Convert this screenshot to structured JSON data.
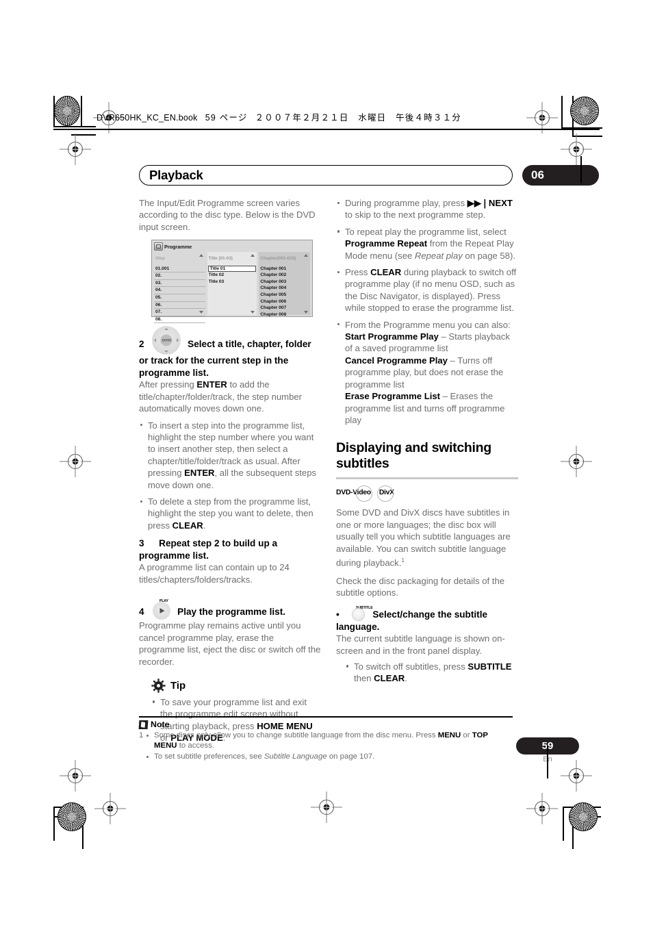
{
  "print_header": {
    "filename": "DVR650HK_KC_EN.book",
    "page_marker": "59 ページ",
    "date_jp": "２００７年２月２１日　水曜日　午後４時３１分"
  },
  "chapter": {
    "title": "Playback",
    "number": "06"
  },
  "left_column": {
    "intro": "The Input/Edit Programme screen varies according to the disc type. Below is the DVD input screen.",
    "osd": {
      "window_title": "Programme",
      "columns": [
        {
          "header": "Step",
          "rows": [
            "01.001",
            "02.",
            "03.",
            "04.",
            "05.",
            "06.",
            "07.",
            "08."
          ]
        },
        {
          "header": "Title (01-03)",
          "rows": [
            "Title 01",
            "Title 02",
            "Title 03"
          ]
        },
        {
          "header": "Chapter(001-015)",
          "rows": [
            "Chapter 001",
            "Chapter 002",
            "Chapter 003",
            "Chapter 004",
            "Chapter 005",
            "Chapter 006",
            "Chapter 007",
            "Chapter 008"
          ]
        }
      ],
      "selected_row": "Title 01"
    },
    "step2": {
      "num": "2",
      "key_caption": "ENTER",
      "heading": "Select a title, chapter, folder or track for the current step in the programme list.",
      "body_pre": "After pressing ",
      "body_bold": "ENTER",
      "body_post": " to add the title/chapter/folder/track, the step number automatically moves down one."
    },
    "step2_bullets": [
      {
        "pre": "To insert a step into the programme list, highlight the step number where you want to insert another step, then select a chapter/title/folder/track as usual. After pressing ",
        "bold": "ENTER",
        "post": ", all the subsequent steps move down one."
      },
      {
        "pre": "To delete a step from the programme list, highlight the step you want to delete, then press ",
        "bold": "CLEAR",
        "post": "."
      }
    ],
    "step3": {
      "num": "3",
      "heading": "Repeat step 2 to build up a programme list.",
      "body": "A programme list can contain up to 24 titles/chapters/folders/tracks."
    },
    "step4": {
      "num": "4",
      "key_caption": "PLAY",
      "heading": "Play the programme list.",
      "body": "Programme play remains active until you cancel programme play, erase the programme list, eject the disc or switch off the recorder."
    },
    "tip": {
      "label": "Tip",
      "bullet_pre": "To save your programme list and exit the programme edit screen without starting playback, press ",
      "bullet_bold1": "HOME MENU",
      "bullet_mid": " or ",
      "bullet_bold2": "PLAY MODE",
      "bullet_post": "."
    }
  },
  "right_column": {
    "bullets": [
      {
        "pre": "During programme play, press ",
        "glyph": "▶▶❘",
        "bold": "NEXT",
        "post": " to skip to the next programme step."
      },
      {
        "pre": "To repeat play the programme list, select ",
        "bold": "Programme Repeat",
        "mid": " from the Repeat Play Mode menu (see ",
        "italic": "Repeat play",
        "post": " on page 58)."
      },
      {
        "pre": "Press ",
        "bold": "CLEAR",
        "post": " during playback to switch off programme play (if no menu OSD, such as the Disc Navigator, is displayed). Press while stopped to erase the programme list."
      }
    ],
    "menu_bullet": {
      "intro": "From the Programme menu you can also:",
      "items": [
        {
          "name": "Start Programme Play",
          "desc": " – Starts playback of a saved programme list"
        },
        {
          "name": "Cancel Programme Play",
          "desc": " – Turns off programme play, but does not erase the programme list"
        },
        {
          "name": "Erase Programme List",
          "desc": " – Erases the programme list and turns off programme play"
        }
      ]
    },
    "section": {
      "heading": "Displaying and switching subtitles",
      "badges": [
        "DVD-Video",
        "DivX"
      ],
      "para1_pre": "Some DVD and DivX discs have subtitles in one or more languages; the disc box will usually tell you which subtitle languages are available. You can switch subtitle language during playback.",
      "para1_footnote": "1",
      "para2": "Check the disc packaging for details of the subtitle options.",
      "step": {
        "bullet": "•",
        "key_caption": "SUBTITLE",
        "heading": "Select/change the subtitle language.",
        "body": "The current subtitle language is shown on-screen and in the front panel display."
      },
      "sub_bullet": {
        "pre": "To switch off subtitles, press ",
        "bold1": "SUBTITLE",
        "mid": " then ",
        "bold2": "CLEAR",
        "post": "."
      }
    }
  },
  "note": {
    "label": "Note",
    "items": [
      {
        "index": "1",
        "pre": "Some discs only allow you to change subtitle language from the disc menu. Press ",
        "bold1": "MENU",
        "mid": " or ",
        "bold2": "TOP MENU",
        "post": " to access."
      },
      {
        "index": "",
        "pre": "To set subtitle preferences, see ",
        "italic": "Subtitle Language",
        "post": " on page 107."
      }
    ]
  },
  "footer": {
    "page_number": "59",
    "language": "En"
  }
}
